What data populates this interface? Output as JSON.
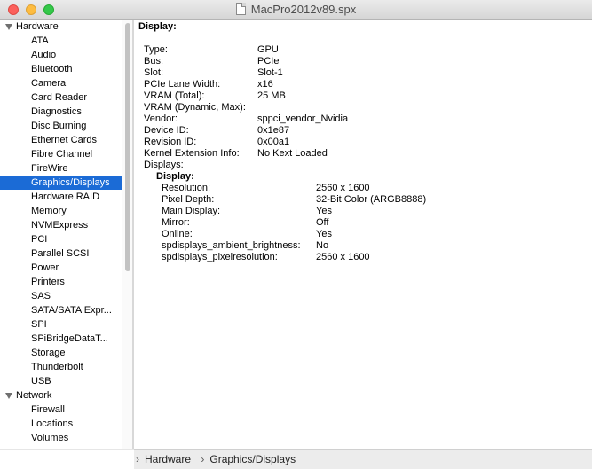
{
  "window": {
    "title": "MacPro2012v89.spx"
  },
  "sidebar": {
    "groups": [
      {
        "label": "Hardware",
        "items": [
          "ATA",
          "Audio",
          "Bluetooth",
          "Camera",
          "Card Reader",
          "Diagnostics",
          "Disc Burning",
          "Ethernet Cards",
          "Fibre Channel",
          "FireWire",
          "Graphics/Displays",
          "Hardware RAID",
          "Memory",
          "NVMExpress",
          "PCI",
          "Parallel SCSI",
          "Power",
          "Printers",
          "SAS",
          "SATA/SATA Expr...",
          "SPI",
          "SPiBridgeDataT...",
          "Storage",
          "Thunderbolt",
          "USB"
        ]
      },
      {
        "label": "Network",
        "items": [
          "Firewall",
          "Locations",
          "Volumes"
        ]
      }
    ],
    "selected": "Graphics/Displays"
  },
  "detail": {
    "heading": "Display:",
    "properties": [
      {
        "label": "Type:",
        "value": "GPU"
      },
      {
        "label": "Bus:",
        "value": "PCIe"
      },
      {
        "label": "Slot:",
        "value": "Slot-1"
      },
      {
        "label": "PCIe Lane Width:",
        "value": "x16"
      },
      {
        "label": "VRAM (Total):",
        "value": "25 MB"
      },
      {
        "label": "VRAM (Dynamic, Max):",
        "value": ""
      },
      {
        "label": "Vendor:",
        "value": "sppci_vendor_Nvidia"
      },
      {
        "label": "Device ID:",
        "value": "0x1e87"
      },
      {
        "label": "Revision ID:",
        "value": "0x00a1"
      },
      {
        "label": "Kernel Extension Info:",
        "value": "No Kext Loaded"
      },
      {
        "label": "Displays:",
        "value": ""
      }
    ],
    "subheading": "Display:",
    "display_properties": [
      {
        "label": "Resolution:",
        "value": "2560 x 1600"
      },
      {
        "label": "Pixel Depth:",
        "value": "32-Bit Color (ARGB8888)"
      },
      {
        "label": "Main Display:",
        "value": "Yes"
      },
      {
        "label": "Mirror:",
        "value": "Off"
      },
      {
        "label": "Online:",
        "value": "Yes"
      },
      {
        "label": "spdisplays_ambient_brightness:",
        "value": "No"
      },
      {
        "label": "spdisplays_pixelresolution:",
        "value": "2560 x 1600"
      }
    ]
  },
  "pathbar": {
    "crumbs": [
      "Hardware",
      "Graphics/Displays"
    ]
  }
}
